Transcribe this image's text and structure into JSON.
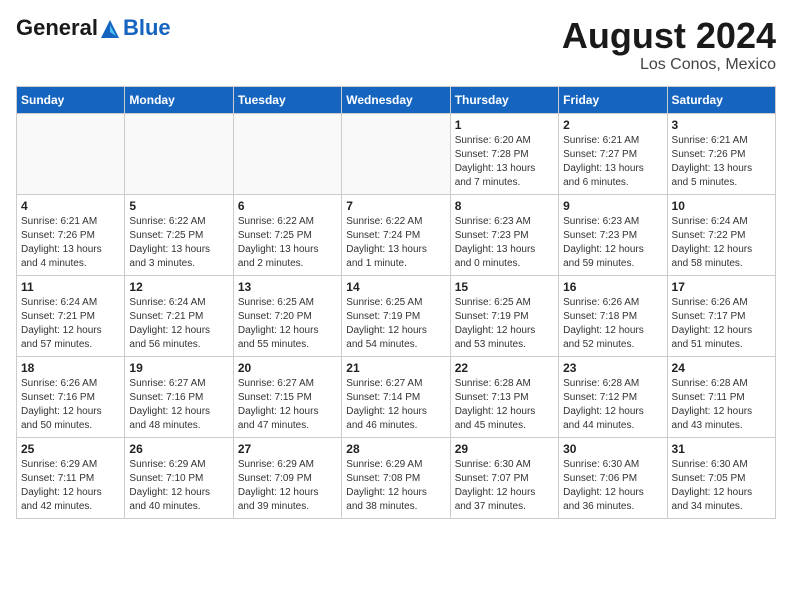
{
  "header": {
    "logo_line1": "General",
    "logo_line2": "Blue",
    "main_title": "August 2024",
    "sub_title": "Los Conos, Mexico"
  },
  "calendar": {
    "days_of_week": [
      "Sunday",
      "Monday",
      "Tuesday",
      "Wednesday",
      "Thursday",
      "Friday",
      "Saturday"
    ],
    "weeks": [
      [
        {
          "day": "",
          "info": ""
        },
        {
          "day": "",
          "info": ""
        },
        {
          "day": "",
          "info": ""
        },
        {
          "day": "",
          "info": ""
        },
        {
          "day": "1",
          "info": "Sunrise: 6:20 AM\nSunset: 7:28 PM\nDaylight: 13 hours\nand 7 minutes."
        },
        {
          "day": "2",
          "info": "Sunrise: 6:21 AM\nSunset: 7:27 PM\nDaylight: 13 hours\nand 6 minutes."
        },
        {
          "day": "3",
          "info": "Sunrise: 6:21 AM\nSunset: 7:26 PM\nDaylight: 13 hours\nand 5 minutes."
        }
      ],
      [
        {
          "day": "4",
          "info": "Sunrise: 6:21 AM\nSunset: 7:26 PM\nDaylight: 13 hours\nand 4 minutes."
        },
        {
          "day": "5",
          "info": "Sunrise: 6:22 AM\nSunset: 7:25 PM\nDaylight: 13 hours\nand 3 minutes."
        },
        {
          "day": "6",
          "info": "Sunrise: 6:22 AM\nSunset: 7:25 PM\nDaylight: 13 hours\nand 2 minutes."
        },
        {
          "day": "7",
          "info": "Sunrise: 6:22 AM\nSunset: 7:24 PM\nDaylight: 13 hours\nand 1 minute."
        },
        {
          "day": "8",
          "info": "Sunrise: 6:23 AM\nSunset: 7:23 PM\nDaylight: 13 hours\nand 0 minutes."
        },
        {
          "day": "9",
          "info": "Sunrise: 6:23 AM\nSunset: 7:23 PM\nDaylight: 12 hours\nand 59 minutes."
        },
        {
          "day": "10",
          "info": "Sunrise: 6:24 AM\nSunset: 7:22 PM\nDaylight: 12 hours\nand 58 minutes."
        }
      ],
      [
        {
          "day": "11",
          "info": "Sunrise: 6:24 AM\nSunset: 7:21 PM\nDaylight: 12 hours\nand 57 minutes."
        },
        {
          "day": "12",
          "info": "Sunrise: 6:24 AM\nSunset: 7:21 PM\nDaylight: 12 hours\nand 56 minutes."
        },
        {
          "day": "13",
          "info": "Sunrise: 6:25 AM\nSunset: 7:20 PM\nDaylight: 12 hours\nand 55 minutes."
        },
        {
          "day": "14",
          "info": "Sunrise: 6:25 AM\nSunset: 7:19 PM\nDaylight: 12 hours\nand 54 minutes."
        },
        {
          "day": "15",
          "info": "Sunrise: 6:25 AM\nSunset: 7:19 PM\nDaylight: 12 hours\nand 53 minutes."
        },
        {
          "day": "16",
          "info": "Sunrise: 6:26 AM\nSunset: 7:18 PM\nDaylight: 12 hours\nand 52 minutes."
        },
        {
          "day": "17",
          "info": "Sunrise: 6:26 AM\nSunset: 7:17 PM\nDaylight: 12 hours\nand 51 minutes."
        }
      ],
      [
        {
          "day": "18",
          "info": "Sunrise: 6:26 AM\nSunset: 7:16 PM\nDaylight: 12 hours\nand 50 minutes."
        },
        {
          "day": "19",
          "info": "Sunrise: 6:27 AM\nSunset: 7:16 PM\nDaylight: 12 hours\nand 48 minutes."
        },
        {
          "day": "20",
          "info": "Sunrise: 6:27 AM\nSunset: 7:15 PM\nDaylight: 12 hours\nand 47 minutes."
        },
        {
          "day": "21",
          "info": "Sunrise: 6:27 AM\nSunset: 7:14 PM\nDaylight: 12 hours\nand 46 minutes."
        },
        {
          "day": "22",
          "info": "Sunrise: 6:28 AM\nSunset: 7:13 PM\nDaylight: 12 hours\nand 45 minutes."
        },
        {
          "day": "23",
          "info": "Sunrise: 6:28 AM\nSunset: 7:12 PM\nDaylight: 12 hours\nand 44 minutes."
        },
        {
          "day": "24",
          "info": "Sunrise: 6:28 AM\nSunset: 7:11 PM\nDaylight: 12 hours\nand 43 minutes."
        }
      ],
      [
        {
          "day": "25",
          "info": "Sunrise: 6:29 AM\nSunset: 7:11 PM\nDaylight: 12 hours\nand 42 minutes."
        },
        {
          "day": "26",
          "info": "Sunrise: 6:29 AM\nSunset: 7:10 PM\nDaylight: 12 hours\nand 40 minutes."
        },
        {
          "day": "27",
          "info": "Sunrise: 6:29 AM\nSunset: 7:09 PM\nDaylight: 12 hours\nand 39 minutes."
        },
        {
          "day": "28",
          "info": "Sunrise: 6:29 AM\nSunset: 7:08 PM\nDaylight: 12 hours\nand 38 minutes."
        },
        {
          "day": "29",
          "info": "Sunrise: 6:30 AM\nSunset: 7:07 PM\nDaylight: 12 hours\nand 37 minutes."
        },
        {
          "day": "30",
          "info": "Sunrise: 6:30 AM\nSunset: 7:06 PM\nDaylight: 12 hours\nand 36 minutes."
        },
        {
          "day": "31",
          "info": "Sunrise: 6:30 AM\nSunset: 7:05 PM\nDaylight: 12 hours\nand 34 minutes."
        }
      ]
    ]
  }
}
